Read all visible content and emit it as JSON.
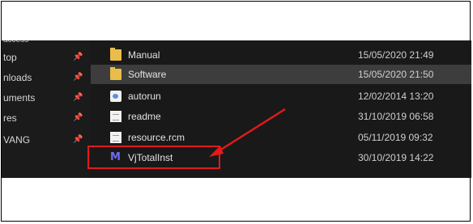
{
  "sidebar": {
    "top_partial": "access",
    "items": [
      {
        "label": "top"
      },
      {
        "label": "nloads"
      },
      {
        "label": "uments"
      },
      {
        "label": "res"
      },
      {
        "label": "VANG"
      }
    ]
  },
  "files": [
    {
      "name": "Manual",
      "date": "15/05/2020 21:49",
      "icon": "folder-icon"
    },
    {
      "name": "Software",
      "date": "15/05/2020 21:50",
      "icon": "folder-icon"
    },
    {
      "name": "autorun",
      "date": "12/02/2014 13:20",
      "icon": "autorun-icon"
    },
    {
      "name": "readme",
      "date": "31/10/2019 06:58",
      "icon": "document-icon"
    },
    {
      "name": "resource.rcm",
      "date": "05/11/2019 09:32",
      "icon": "document-icon"
    },
    {
      "name": "VjTotalInst",
      "date": "30/10/2019 14:22",
      "icon": "installer-app-icon"
    }
  ],
  "annotation": {
    "color": "#e11b1b"
  }
}
